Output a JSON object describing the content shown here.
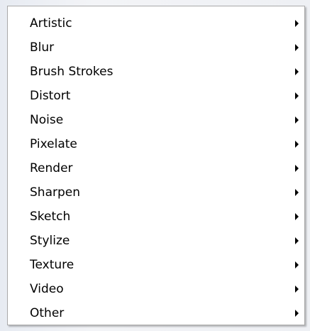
{
  "filter_menu": {
    "items": [
      {
        "label": "Artistic",
        "icon": "chevron-right-icon"
      },
      {
        "label": "Blur",
        "icon": "chevron-right-icon"
      },
      {
        "label": "Brush Strokes",
        "icon": "chevron-right-icon"
      },
      {
        "label": "Distort",
        "icon": "chevron-right-icon"
      },
      {
        "label": "Noise",
        "icon": "chevron-right-icon"
      },
      {
        "label": "Pixelate",
        "icon": "chevron-right-icon"
      },
      {
        "label": "Render",
        "icon": "chevron-right-icon"
      },
      {
        "label": "Sharpen",
        "icon": "chevron-right-icon"
      },
      {
        "label": "Sketch",
        "icon": "chevron-right-icon"
      },
      {
        "label": "Stylize",
        "icon": "chevron-right-icon"
      },
      {
        "label": "Texture",
        "icon": "chevron-right-icon"
      },
      {
        "label": "Video",
        "icon": "chevron-right-icon"
      },
      {
        "label": "Other",
        "icon": "chevron-right-icon"
      }
    ]
  }
}
